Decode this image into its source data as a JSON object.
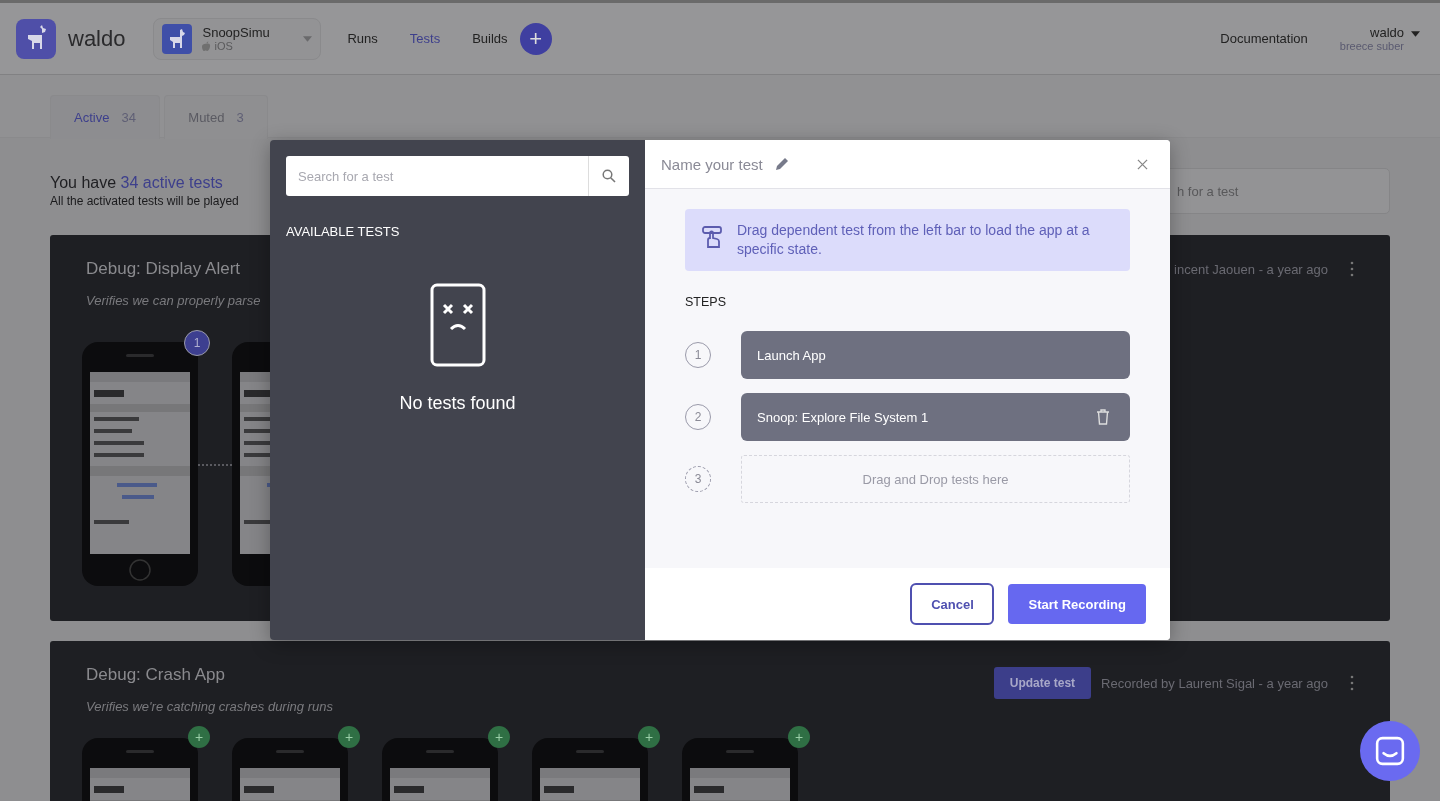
{
  "header": {
    "brand": "waldo",
    "app": {
      "name": "SnoopSimu",
      "platform": "iOS"
    },
    "nav": [
      {
        "label": "Runs",
        "selected": false
      },
      {
        "label": "Tests",
        "selected": true
      },
      {
        "label": "Builds",
        "selected": false
      }
    ],
    "add": "+",
    "documentation": "Documentation",
    "user": {
      "name": "waldo",
      "org": "breece suber"
    }
  },
  "tabs": [
    {
      "label": "Active",
      "count": "34",
      "selected": true
    },
    {
      "label": "Muted",
      "count": "3",
      "selected": false
    }
  ],
  "summary": {
    "prefix": "You have",
    "link": "34 active tests",
    "subtitle": "All the activated tests will be played"
  },
  "search": {
    "placeholder": "h for a test"
  },
  "tests": [
    {
      "title": "Debug: Display Alert",
      "description": "Verifies we can properly parse",
      "recorded": "incent Jaouen - a year ago",
      "screens": [
        {
          "badge": "1",
          "kind": "number"
        },
        {
          "kind": "plain"
        }
      ]
    },
    {
      "title": "Debug: Crash App",
      "description": "Verifies we're catching crashes during runs",
      "update_button": "Update test",
      "recorded": "Recorded by Laurent Sigal - a year ago",
      "screens": [
        {
          "badge": "+",
          "kind": "add"
        },
        {
          "badge": "+",
          "kind": "add"
        },
        {
          "badge": "+",
          "kind": "add"
        },
        {
          "badge": "+",
          "kind": "add"
        },
        {
          "badge": "+",
          "kind": "add"
        }
      ]
    }
  ],
  "modal": {
    "search": {
      "placeholder": "Search for a test"
    },
    "available_heading": "AVAILABLE TESTS",
    "empty_message": "No tests found",
    "name_placeholder": "Name your test",
    "hint": "Drag dependent test from the left bar to load the app at a specific state.",
    "steps_heading": "STEPS",
    "steps": [
      {
        "number": "1",
        "kind": "step",
        "label": "Launch App",
        "deletable": false
      },
      {
        "number": "2",
        "kind": "step",
        "label": "Snoop: Explore File System 1",
        "deletable": true
      },
      {
        "number": "3",
        "kind": "dropzone",
        "label": "Drag and Drop tests here"
      }
    ],
    "cancel": "Cancel",
    "start": "Start Recording"
  }
}
